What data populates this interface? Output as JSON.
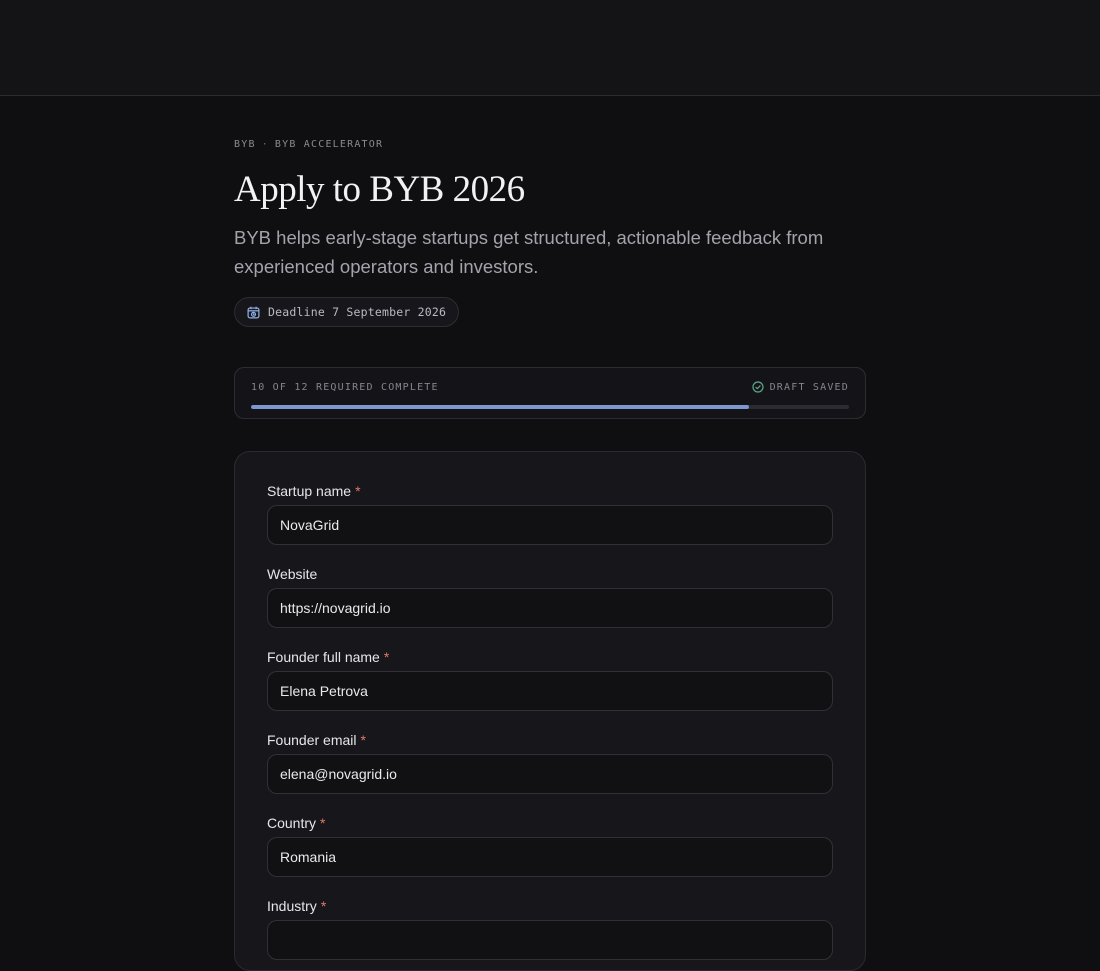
{
  "header": {
    "breadcrumb": [
      "BYB",
      "BYB ACCELERATOR"
    ],
    "breadcrumb_separator": "·",
    "title": "Apply to BYB 2026",
    "subtitle": "BYB helps early-stage startups get structured, actionable feedback from experienced operators and investors.",
    "deadline_label": "Deadline 7 September 2026",
    "deadline_icon": "calendar-clock-icon"
  },
  "progress": {
    "label": "10 OF 12 REQUIRED COMPLETE",
    "completed": 10,
    "required": 12,
    "fraction": 0.833,
    "status_label": "DRAFT SAVED",
    "status_icon": "check-circle-icon"
  },
  "form": {
    "fields": [
      {
        "label": "Startup name",
        "required": true,
        "value": "NovaGrid"
      },
      {
        "label": "Website",
        "required": false,
        "value": "https://novagrid.io"
      },
      {
        "label": "Founder full name",
        "required": true,
        "value": "Elena Petrova"
      },
      {
        "label": "Founder email",
        "required": true,
        "value": "elena@novagrid.io"
      },
      {
        "label": "Country",
        "required": true,
        "value": "Romania"
      },
      {
        "label": "Industry",
        "required": true,
        "value": ""
      }
    ],
    "required_marker": "*"
  },
  "colors": {
    "accent": "#7d97cf",
    "required": "#e0796a",
    "success": "#5fa889",
    "background": "#0f0f11"
  }
}
